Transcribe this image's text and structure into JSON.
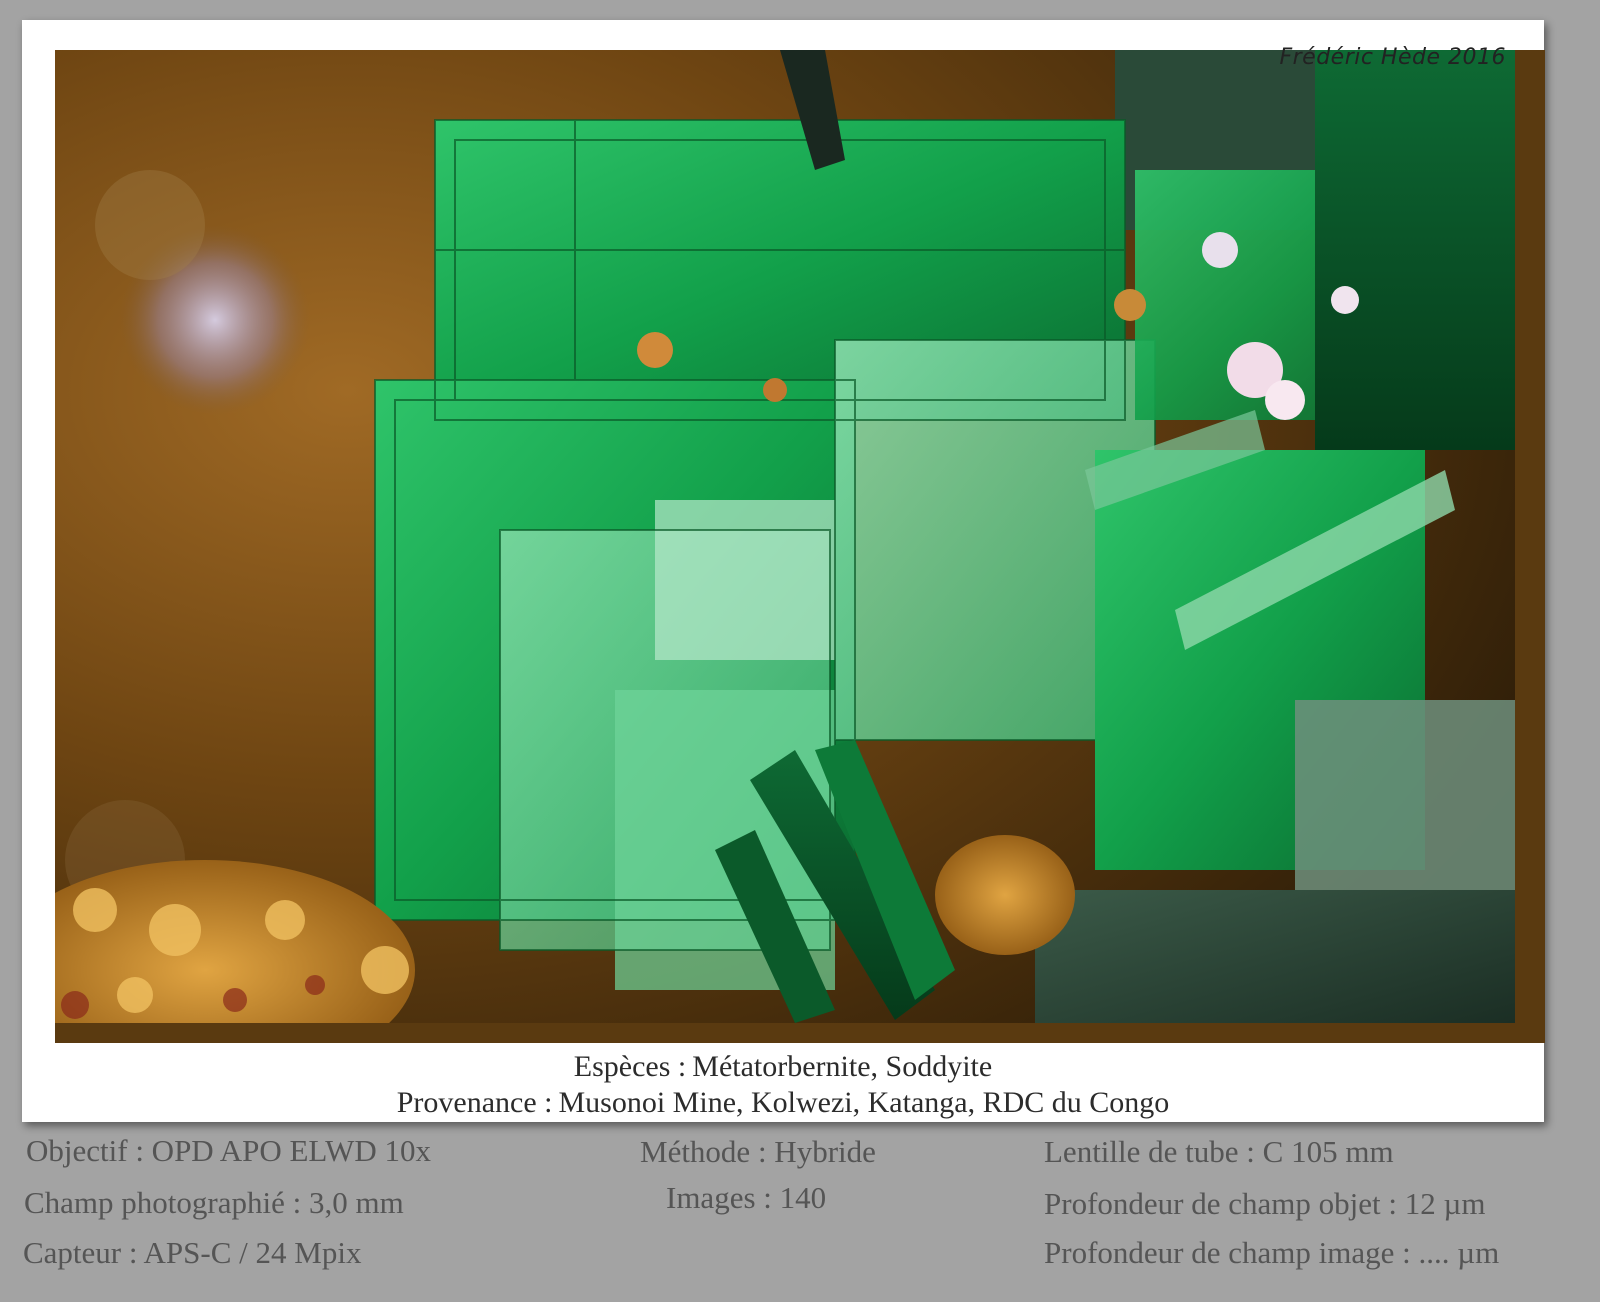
{
  "signature": "Frédéric Hède 2016",
  "caption": {
    "species_label": "Espèces :",
    "species_value": "Métatorbernite, Soddyite",
    "origin_label": "Provenance :",
    "origin_value": "Musonoi Mine, Kolwezi, Katanga, RDC du Congo"
  },
  "details": {
    "objective": "Objectif : OPD APO ELWD 10x",
    "field": "Champ photographié : 3,0 mm",
    "sensor": "Capteur : APS-C / 24 Mpix",
    "method": "Méthode : Hybride",
    "images": "Images : 140",
    "tube_lens": "Lentille de tube : C 105 mm",
    "dof_object": "Profondeur de champ objet : 12 µm",
    "dof_image": "Profondeur de champ image : .... µm"
  },
  "colors": {
    "background": "#a3a3a3",
    "frame": "#ffffff",
    "crystal_green": "#0fa64a",
    "matrix_brown": "#6b4210"
  }
}
